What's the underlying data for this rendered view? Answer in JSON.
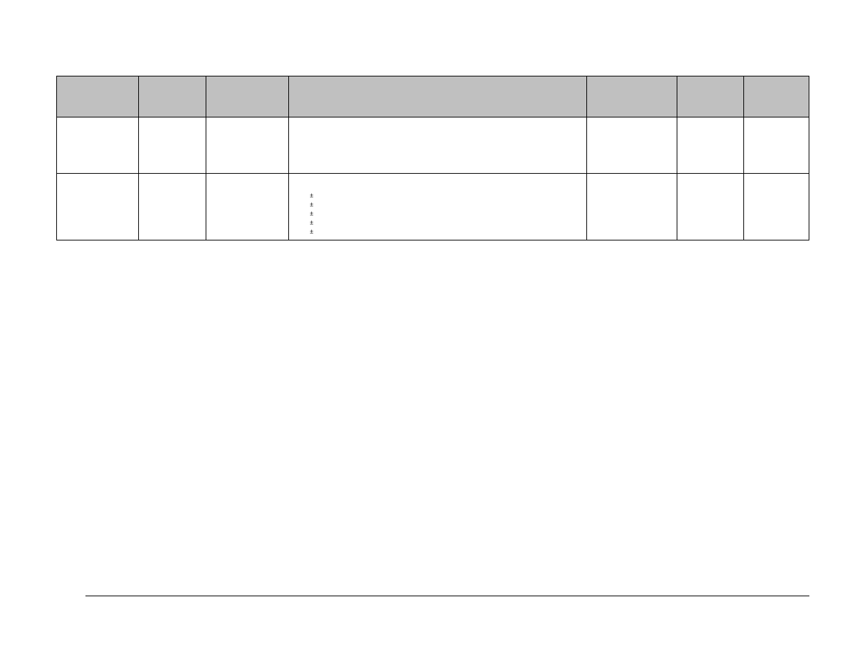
{
  "table": {
    "headers": [
      "",
      "",
      "",
      "",
      "",
      "",
      ""
    ]
  },
  "pm_lines": [
    "±",
    "±",
    "±",
    "±",
    "±"
  ]
}
